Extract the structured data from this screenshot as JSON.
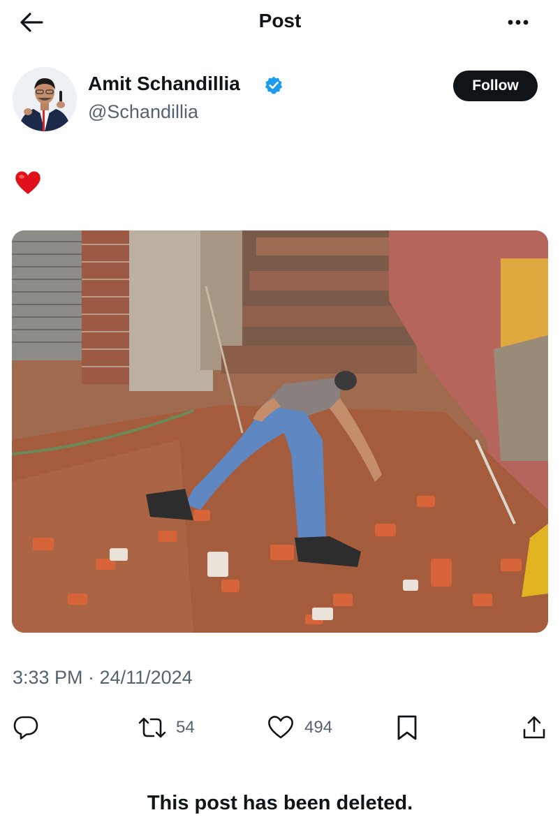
{
  "header": {
    "title": "Post"
  },
  "author": {
    "display_name": "Amit Schandillia",
    "handle": "@Schandillia",
    "verified": true
  },
  "follow_label": "Follow",
  "post": {
    "text_emoji": "heart",
    "timestamp": "3:33 PM · 24/11/2024",
    "photo_description": "photo"
  },
  "actions": {
    "reply_count": "",
    "repost_count": "54",
    "like_count": "494",
    "bookmark_count": ""
  },
  "notice": "This post has been deleted.",
  "colors": {
    "accent": "#1d9bf0",
    "text": "#0f1419",
    "muted": "#536471",
    "button_bg": "#0f1419",
    "heart": "#e0101a"
  }
}
